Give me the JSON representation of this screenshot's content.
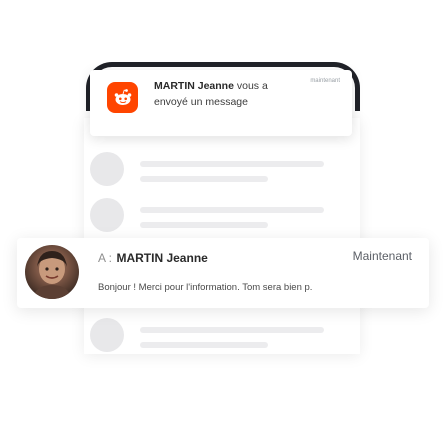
{
  "notification": {
    "time": "maintenant",
    "sender": "MARTIN Jeanne",
    "text_suffix": " vous a",
    "text_line2": "envoyé un message",
    "app_icon": "reddit-icon",
    "accent_color": "#ff4500"
  },
  "message": {
    "to_label": "A :",
    "recipient": "MARTIN Jeanne",
    "time": "Maintenant",
    "body": "Bonjour ! Merci pour l'information. Tom sera bien p.",
    "avatar": "profile-photo"
  }
}
